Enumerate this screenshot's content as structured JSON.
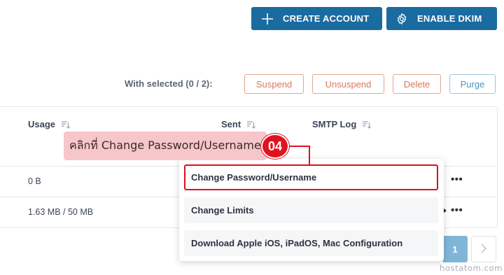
{
  "toolbar": {
    "create_account_label": "CREATE ACCOUNT",
    "create_account_icon": "plus-icon",
    "enable_dkim_label": "ENABLE DKIM",
    "enable_dkim_icon": "gear-icon"
  },
  "bulk_actions": {
    "with_selected_label": "With selected (0 / 2):",
    "buttons": [
      "Suspend",
      "Unsuspend",
      "Delete",
      "Purge"
    ]
  },
  "table": {
    "columns": [
      "Usage",
      "Sent",
      "SMTP Log"
    ],
    "rows": [
      {
        "usage": "0 B"
      },
      {
        "usage": "1.63 MB / 50 MB"
      }
    ],
    "row_menu_icon": "more-horizontal-icon"
  },
  "annotation": {
    "text": "คลิกที่ Change Password/Username",
    "step": "04"
  },
  "dropdown": {
    "items": [
      "Change Password/Username",
      "Change Limits",
      "Download Apple iOS, iPadOS, Mac Configuration"
    ],
    "highlighted_item": "Change Password/Username"
  },
  "pagination": {
    "current_page": "1",
    "next_icon": "chevron-right-icon"
  },
  "watermark": "hostatom.com",
  "colors": {
    "primary": "#1a6ba0",
    "danger_outline": "#d9785a",
    "info_outline": "#4e93c2",
    "highlight_red": "#e0121f",
    "callout_bg": "#f6c6cb"
  }
}
